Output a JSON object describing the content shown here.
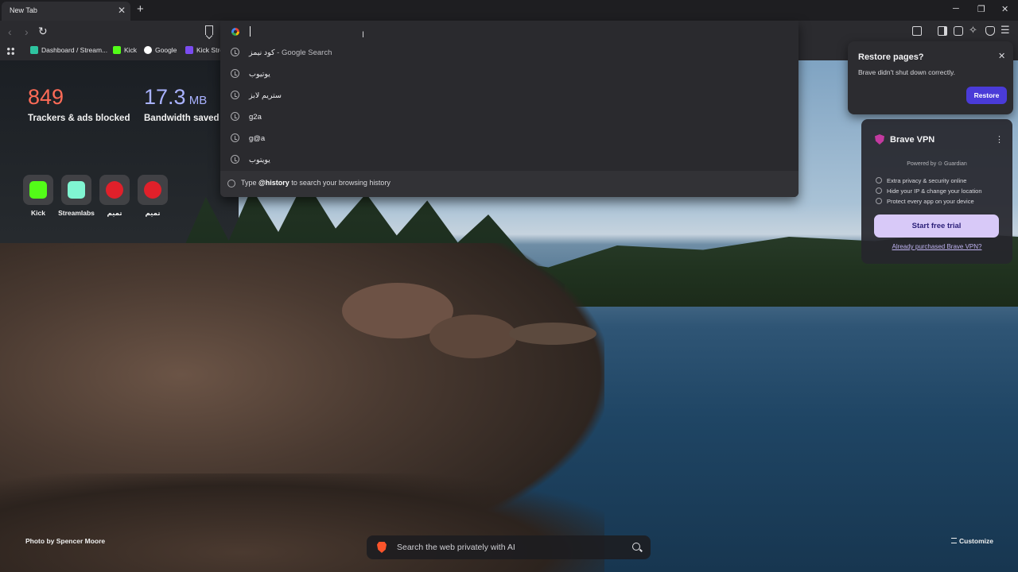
{
  "tab": {
    "title": "New Tab",
    "close": "✕",
    "new_tab": "+"
  },
  "window": {
    "minimize": "─",
    "restore": "❐",
    "close": "✕"
  },
  "bookmarks": [
    {
      "label": "Dashboard / Stream...",
      "color": "#2ec4a0"
    },
    {
      "label": "Kick",
      "color": "#53fc18"
    },
    {
      "label": "Google",
      "color": "#ffffff"
    },
    {
      "label": "Kick Stre",
      "color": "#7b4cf0"
    }
  ],
  "omnibox": {
    "suggestions": [
      {
        "text": "كود نيمز",
        "suffix": " - Google Search"
      },
      {
        "text": "يوتيوب",
        "suffix": ""
      },
      {
        "text": "ستريم لابز",
        "suffix": ""
      },
      {
        "text": "g2a",
        "suffix": ""
      },
      {
        "text": "g@a",
        "suffix": ""
      },
      {
        "text": "يويتوب",
        "suffix": ""
      }
    ],
    "hint_prefix": "Type ",
    "hint_keyword": "@history",
    "hint_suffix": " to search your browsing history"
  },
  "stats": {
    "trackers_value": "849",
    "trackers_label": "Trackers & ads blocked",
    "bandwidth_value": "17.3",
    "bandwidth_unit": " MB",
    "bandwidth_label": "Bandwidth saved"
  },
  "top_sites": [
    {
      "label": "Kick",
      "color": "#53fc18"
    },
    {
      "label": "Streamlabs",
      "color": "#80f5d2"
    },
    {
      "label": "تميم",
      "color": "#e0202a"
    },
    {
      "label": "تميم",
      "color": "#e0202a"
    }
  ],
  "restore": {
    "title": "Restore pages?",
    "message": "Brave didn't shut down correctly.",
    "button": "Restore",
    "close": "✕"
  },
  "vpn": {
    "title": "Brave VPN",
    "menu": "⋮",
    "powered_by": "Powered by ⊙ Guardian",
    "features": [
      "Extra privacy & security online",
      "Hide your IP & change your location",
      "Protect every app on your device"
    ],
    "cta": "Start free trial",
    "link": "Already purchased Brave VPN?"
  },
  "footer": {
    "photo_credit": "Photo by Spencer Moore",
    "search_placeholder": "Search the web privately with AI",
    "customize": "Customize"
  },
  "colors": {
    "trackers": "#ff6b57",
    "bandwidth": "#a9b2ff",
    "accent": "#4a3bd8"
  }
}
